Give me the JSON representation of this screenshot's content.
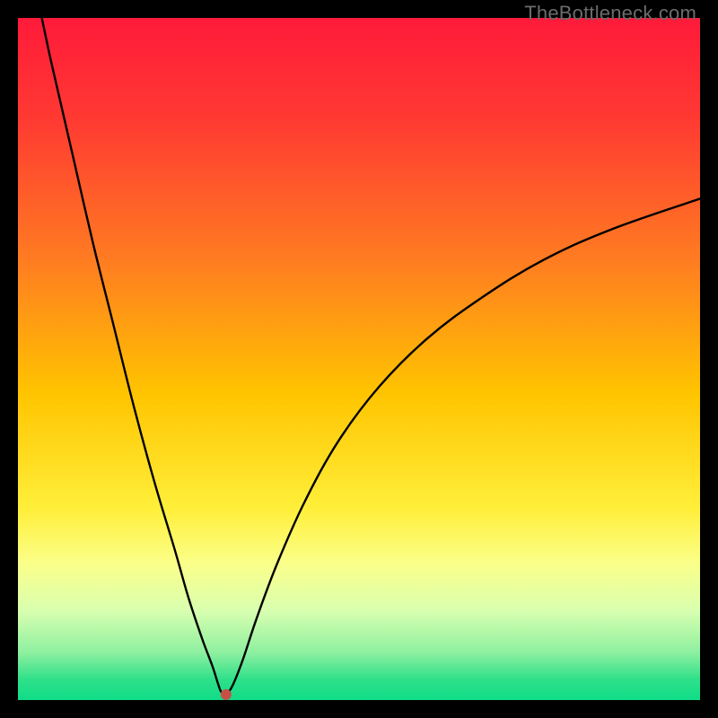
{
  "watermark": "TheBottleneck.com",
  "chart_data": {
    "type": "line",
    "title": "",
    "xlabel": "",
    "ylabel": "",
    "xlim": [
      0,
      100
    ],
    "ylim": [
      0,
      100
    ],
    "grid": false,
    "gradient_stops": [
      {
        "offset": 0.0,
        "color": "#ff1a3a"
      },
      {
        "offset": 0.15,
        "color": "#ff3a32"
      },
      {
        "offset": 0.35,
        "color": "#ff7a22"
      },
      {
        "offset": 0.55,
        "color": "#ffc400"
      },
      {
        "offset": 0.72,
        "color": "#ffef3a"
      },
      {
        "offset": 0.8,
        "color": "#fbff8a"
      },
      {
        "offset": 0.87,
        "color": "#d8ffb0"
      },
      {
        "offset": 0.93,
        "color": "#8ef0a0"
      },
      {
        "offset": 0.97,
        "color": "#2fe08a"
      },
      {
        "offset": 1.0,
        "color": "#0fdc87"
      }
    ],
    "marker": {
      "x": 30.5,
      "y": 0.8,
      "color": "#c75046",
      "radius": 6
    },
    "series": [
      {
        "name": "bottleneck-curve",
        "x": [
          3.5,
          5,
          8,
          11,
          14,
          17,
          20,
          23,
          25,
          27,
          28.5,
          29.3,
          29.8,
          30.5,
          31.5,
          33,
          35,
          38,
          42,
          47,
          53,
          60,
          68,
          77,
          87,
          100
        ],
        "y": [
          100,
          93,
          80,
          67,
          55,
          43,
          32,
          22,
          15,
          9,
          5,
          2.5,
          1.2,
          0.8,
          2.2,
          6,
          12,
          20,
          29,
          38,
          46,
          53,
          59,
          64.5,
          69,
          73.5
        ]
      }
    ]
  }
}
